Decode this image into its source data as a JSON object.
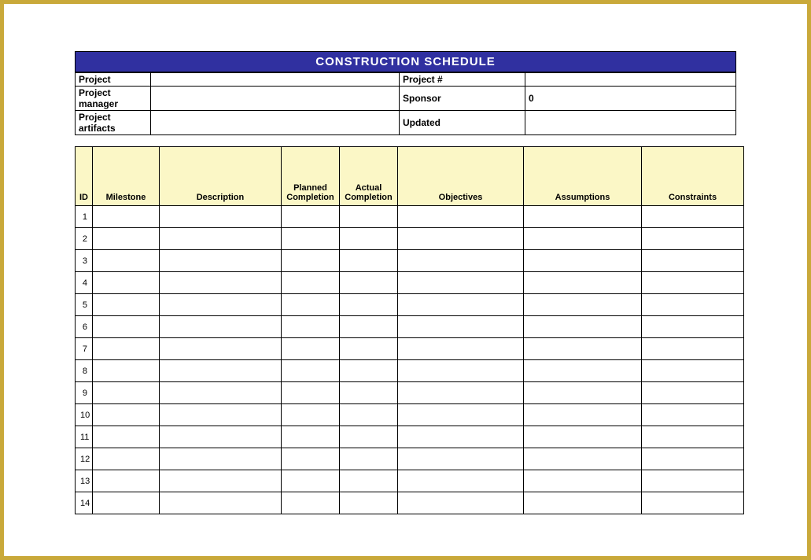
{
  "title": "CONSTRUCTION SCHEDULE",
  "header": {
    "project_label": "Project",
    "project_value": "",
    "project_num_label": "Project #",
    "project_num_value": "",
    "pm_label": "Project manager",
    "pm_value": "",
    "sponsor_label": "Sponsor",
    "sponsor_value": "0",
    "artifacts_label": "Project artifacts",
    "artifacts_value": "",
    "updated_label": "Updated",
    "updated_value": ""
  },
  "columns": {
    "id": "ID",
    "milestone": "Milestone",
    "description": "Description",
    "planned": "Planned Completion",
    "actual": "Actual Completion",
    "objectives": "Objectives",
    "assumptions": "Assumptions",
    "constraints": "Constraints"
  },
  "rows": [
    {
      "id": "1"
    },
    {
      "id": "2"
    },
    {
      "id": "3"
    },
    {
      "id": "4"
    },
    {
      "id": "5"
    },
    {
      "id": "6"
    },
    {
      "id": "7"
    },
    {
      "id": "8"
    },
    {
      "id": "9"
    },
    {
      "id": "10"
    },
    {
      "id": "11"
    },
    {
      "id": "12"
    },
    {
      "id": "13"
    },
    {
      "id": "14"
    }
  ]
}
